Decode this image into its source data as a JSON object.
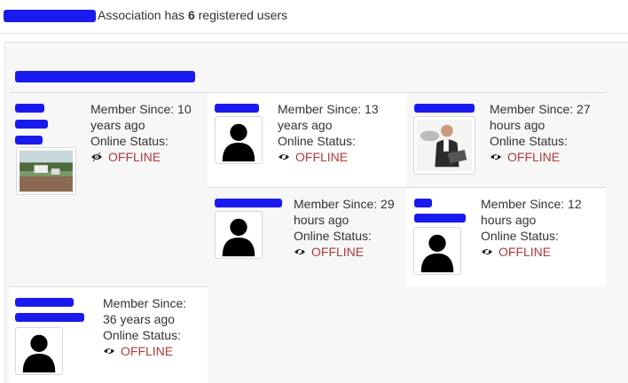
{
  "header": {
    "suffix_text": "Association has",
    "user_count": "6",
    "count_suffix": "registered users"
  },
  "labels": {
    "member_since": "Member Since:",
    "online_status": "Online Status:"
  },
  "users": [
    {
      "since": "10 years ago",
      "status": "OFFLINE",
      "avatar": "photo-landscape"
    },
    {
      "since": "13 years ago",
      "status": "OFFLINE",
      "avatar": "silhouette"
    },
    {
      "since": "27 hours ago",
      "status": "OFFLINE",
      "avatar": "photo-person-laptop"
    },
    {
      "since": "29 hours ago",
      "status": "OFFLINE",
      "avatar": "silhouette"
    },
    {
      "since": "12 hours ago",
      "status": "OFFLINE",
      "avatar": "silhouette"
    },
    {
      "since": "36 years ago",
      "status": "OFFLINE",
      "avatar": "silhouette"
    }
  ],
  "colors": {
    "offline": "#b03a3a",
    "redaction": "#1a1aee"
  }
}
